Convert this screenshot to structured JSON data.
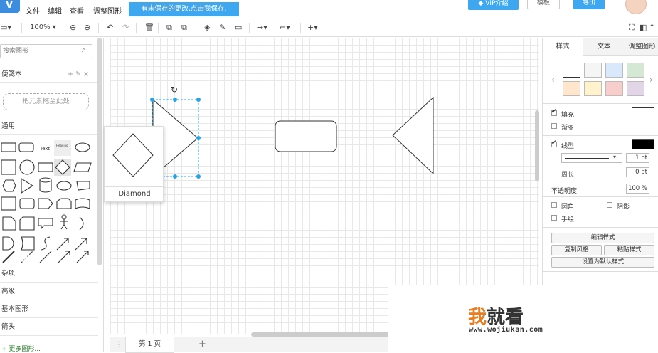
{
  "menubar": {
    "logo_text": "V",
    "items": [
      "文件",
      "编辑",
      "查看",
      "调整图形"
    ],
    "save_notice": "有未保存的更改,点击我保存.",
    "vip_label": "VIP介绍",
    "template_label": "模板",
    "export_label": "导出"
  },
  "toolbar": {
    "zoom": "100%"
  },
  "sidebar": {
    "search_placeholder": "搜索图形",
    "scratchpad_title": "便笺本",
    "scratchpad_tools": "+ ✎ ×",
    "drop_hint": "把元素拖至此处",
    "general_title": "通用",
    "text_shape": "Text",
    "heading_shape": "Heading",
    "misc_title": "杂项",
    "advanced_title": "高级",
    "basic_title": "基本图形",
    "arrows_title": "箭头",
    "more_shapes": "+ 更多图形..."
  },
  "preview": {
    "label": "Diamond"
  },
  "pages": {
    "current_tab": "第 1 页",
    "add_label": "+"
  },
  "format_panel": {
    "tabs": [
      "样式",
      "文本",
      "调整图形"
    ],
    "swatch_colors": [
      "#ffffff",
      "#f5f5f5",
      "#dae8fc",
      "#d5e8d4",
      "#ffe6cc",
      "#fff2cc",
      "#f8cecc",
      "#e1d5e7"
    ],
    "fill_label": "填充",
    "fill_color": "#ffffff",
    "gradient_label": "渐变",
    "line_label": "线型",
    "line_color": "#000000",
    "line_width": "1 pt",
    "perimeter_label": "周长",
    "perimeter_value": "0 pt",
    "opacity_label": "不透明度",
    "opacity_value": "100 %",
    "rounded_label": "圆角",
    "shadow_label": "阴影",
    "sketch_label": "手绘",
    "edit_style": "编辑样式",
    "copy_style": "复制风格",
    "paste_style": "粘贴样式",
    "set_default": "设置为默认样式"
  },
  "watermark": {
    "brand": "我就看",
    "url": "www.wojiukan.com"
  },
  "colors": {
    "accent": "#3ea7f0",
    "selection": "#29a3e5"
  }
}
